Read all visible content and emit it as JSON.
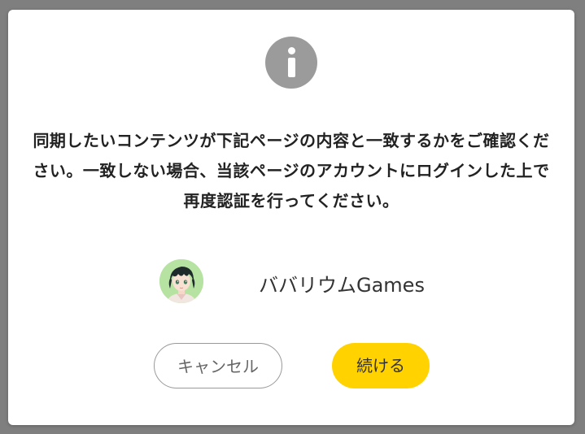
{
  "dialog": {
    "icon": "info-icon",
    "message": "同期したいコンテンツが下記ページの内容と一致するかをご確認ください。一致しない場合、当該ページのアカウントにログインした上で再度認証を行ってください。",
    "account": {
      "name": "ババリウムGames",
      "avatar": "avatar-image"
    },
    "buttons": {
      "cancel_label": "キャンセル",
      "continue_label": "続ける"
    }
  },
  "colors": {
    "overlay": "#7f7f7f",
    "icon_bg": "#9b9b9b",
    "primary": "#ffd200",
    "avatar_bg": "#b6e3a2"
  }
}
